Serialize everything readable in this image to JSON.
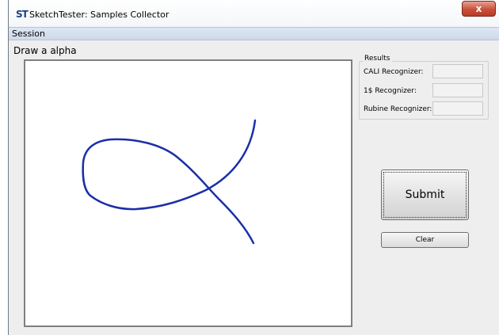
{
  "window": {
    "title": "SketchTester: Samples Collector",
    "close_symbol": "x",
    "app_icon_text": "ST"
  },
  "menu": {
    "items": [
      {
        "label": "Session"
      }
    ]
  },
  "prompt": {
    "text": "Draw a alpha"
  },
  "results": {
    "legend": "Results",
    "rows": [
      {
        "label": "CALI Recognizer:",
        "value": ""
      },
      {
        "label": "1$ Recognizer:",
        "value": ""
      },
      {
        "label": "Rubine Recognizer:",
        "value": ""
      }
    ]
  },
  "buttons": {
    "submit": "Submit",
    "clear": "Clear"
  },
  "stroke": {
    "color": "#1a2fa8"
  }
}
